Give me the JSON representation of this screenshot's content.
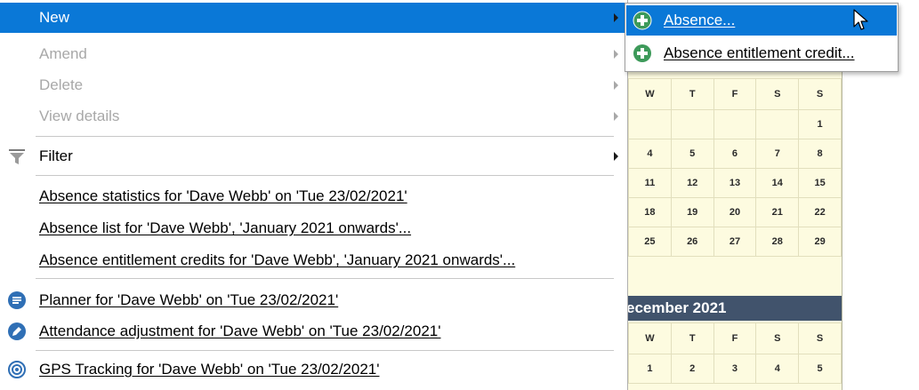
{
  "menu": {
    "items": [
      {
        "label": "New",
        "state": "highlighted"
      },
      {
        "label": "Amend",
        "state": "disabled"
      },
      {
        "label": "Delete",
        "state": "disabled"
      },
      {
        "label": "View details",
        "state": "disabled"
      },
      {
        "label": "Filter",
        "icon": "filter-funnel-icon"
      },
      {
        "label": "Absence statistics for 'Dave Webb' on 'Tue 23/02/2021'"
      },
      {
        "label": "Absence list for 'Dave Webb', 'January 2021 onwards'..."
      },
      {
        "label": "Absence entitlement credits for 'Dave Webb', 'January 2021 onwards'..."
      },
      {
        "label": "Planner for 'Dave Webb' on 'Tue 23/02/2021'",
        "icon": "planner-icon"
      },
      {
        "label": "Attendance adjustment for 'Dave Webb' on 'Tue 23/02/2021'",
        "icon": "pencil-icon"
      },
      {
        "label": "GPS Tracking for 'Dave Webb' on 'Tue 23/02/2021'",
        "icon": "gps-target-icon"
      }
    ]
  },
  "submenu": {
    "items": [
      {
        "label": "Absence...",
        "icon": "add-icon",
        "state": "highlighted"
      },
      {
        "label": "Absence entitlement credit...",
        "icon": "add-icon"
      }
    ]
  },
  "calendar": {
    "weekday_headers": [
      "W",
      "T",
      "F",
      "S",
      "S"
    ],
    "top_rows": [
      [
        "",
        "",
        "",
        "",
        "1"
      ],
      [
        "4",
        "5",
        "6",
        "7",
        "8"
      ],
      [
        "11",
        "12",
        "13",
        "14",
        "15"
      ],
      [
        "18",
        "19",
        "20",
        "21",
        "22"
      ],
      [
        "25",
        "26",
        "27",
        "28",
        "29"
      ]
    ],
    "bottom_month_title": "ecember 2021",
    "bottom_rows": [
      [
        "1",
        "2",
        "3",
        "4",
        "5"
      ]
    ]
  },
  "colors": {
    "highlight": "#0a78d7",
    "calendar_bg": "#fdfbe0",
    "month_header_bg": "#41536c",
    "add_icon": "#3d9a5a"
  }
}
